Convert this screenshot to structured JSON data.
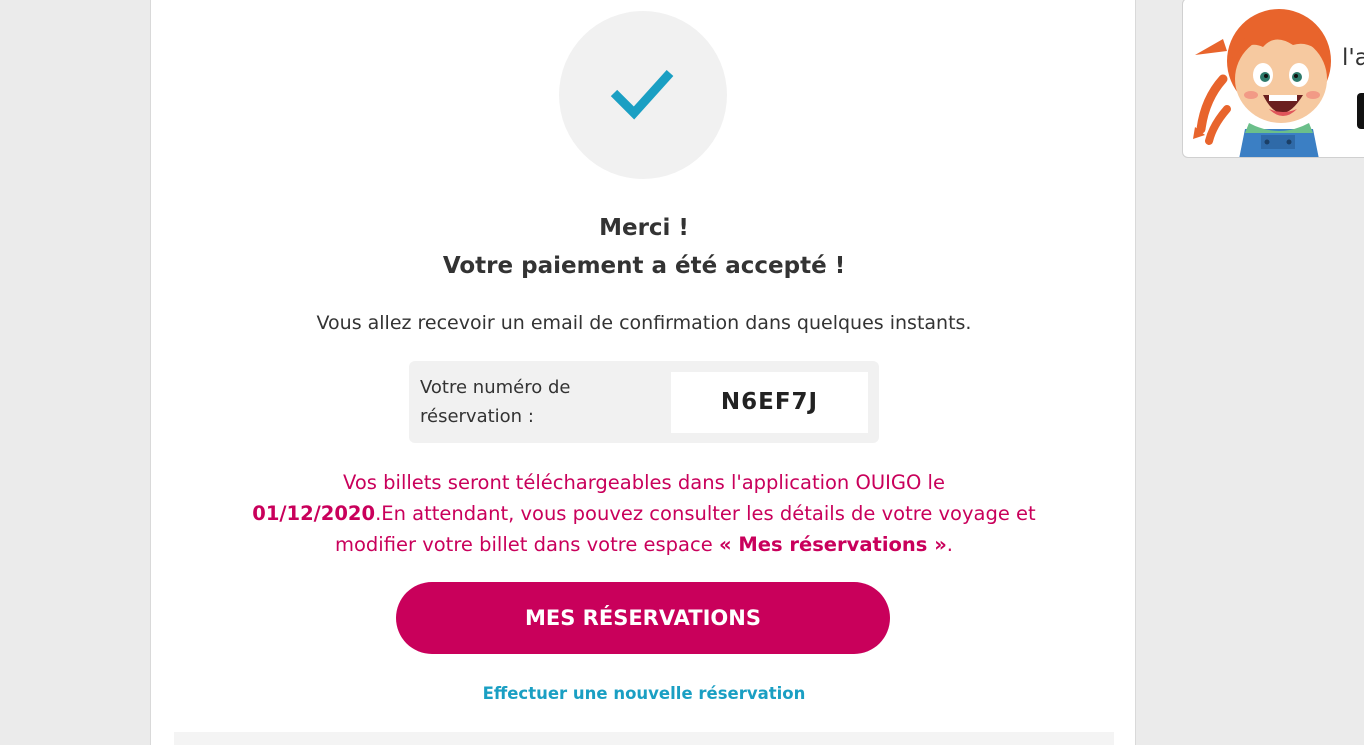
{
  "confirmation": {
    "title_line1": "Merci !",
    "title_line2": "Votre paiement a été accepté !",
    "subtitle": "Vous allez recevoir un email de confirmation dans quelques instants.",
    "reservation_label": "Votre numéro de réservation :",
    "reservation_code": "N6EF7J"
  },
  "info": {
    "text_before_date": "Vos billets seront téléchargeables dans l'application OUIGO le",
    "date": "01/12/2020",
    "text_after_date": ".En attendant, vous pouvez consulter les détails de votre voyage et modifier votre billet dans votre espace",
    "link_text": "« Mes réservations »",
    "text_end": "."
  },
  "actions": {
    "main_button": "MES RÉSERVATIONS",
    "new_reservation_link": "Effectuer une nouvelle réservation"
  },
  "promo": {
    "text_fragment": "l'a"
  },
  "colors": {
    "accent": "#c9005b",
    "check": "#1a9fc3",
    "link": "#1a9fc3"
  }
}
